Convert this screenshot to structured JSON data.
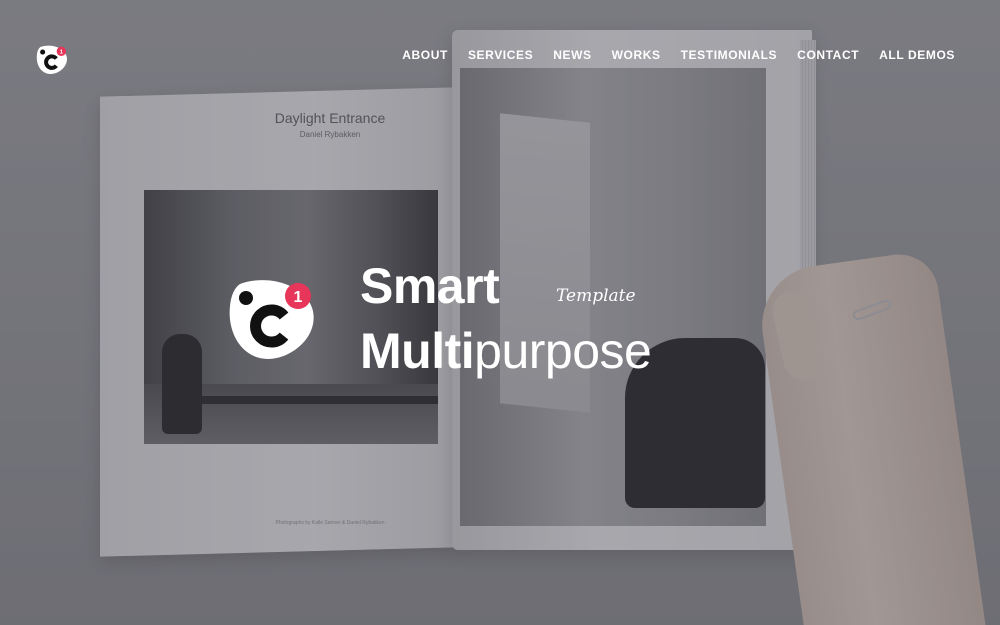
{
  "brand": {
    "logo_letter": "c",
    "badge_number": "1",
    "accent_color": "#e8355a"
  },
  "nav": {
    "items": [
      {
        "label": "ABOUT"
      },
      {
        "label": "SERVICES"
      },
      {
        "label": "NEWS"
      },
      {
        "label": "WORKS"
      },
      {
        "label": "TESTIMONIALS"
      },
      {
        "label": "CONTACT"
      },
      {
        "label": "ALL DEMOS"
      }
    ]
  },
  "hero": {
    "line1": "Smart",
    "tag": "Template",
    "line2_bold": "Multi",
    "line2_light": "purpose"
  },
  "background_book": {
    "page_title": "Daylight Entrance",
    "page_author": "Daniel Rybakken",
    "page_caption": "Photographs by Kalle Sanner & Daniel Rybakken"
  }
}
